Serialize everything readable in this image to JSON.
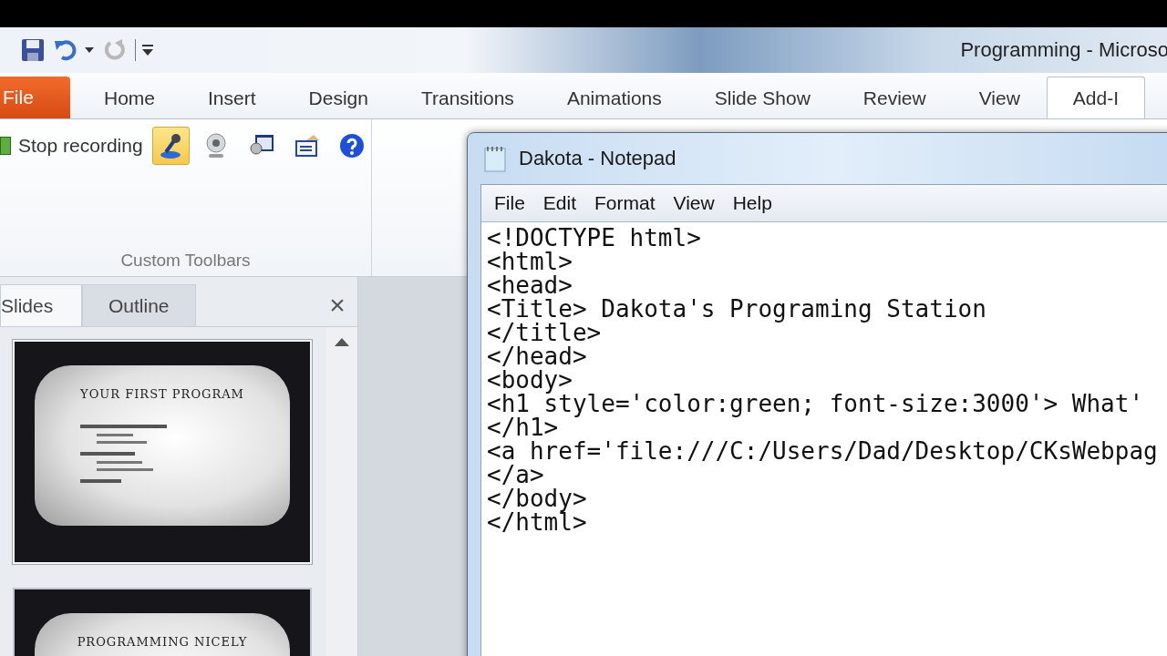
{
  "window": {
    "title": "Programming - Microso"
  },
  "ribbon_tabs": [
    {
      "label": "File",
      "kind": "file",
      "selected": false
    },
    {
      "label": "Home",
      "kind": "tab",
      "selected": false
    },
    {
      "label": "Insert",
      "kind": "tab",
      "selected": false
    },
    {
      "label": "Design",
      "kind": "tab",
      "selected": false
    },
    {
      "label": "Transitions",
      "kind": "tab",
      "selected": false
    },
    {
      "label": "Animations",
      "kind": "tab",
      "selected": false
    },
    {
      "label": "Slide Show",
      "kind": "tab",
      "selected": false
    },
    {
      "label": "Review",
      "kind": "tab",
      "selected": false
    },
    {
      "label": "View",
      "kind": "tab",
      "selected": false
    },
    {
      "label": "Add-I",
      "kind": "tab",
      "selected": true
    }
  ],
  "ribbon_group": {
    "label": "Custom Toolbars",
    "stop_button": "Stop recording",
    "tools": [
      {
        "kind": "narration",
        "pressed": true
      },
      {
        "kind": "webcam",
        "pressed": false
      },
      {
        "kind": "screen",
        "pressed": false
      },
      {
        "kind": "export",
        "pressed": false
      },
      {
        "kind": "help",
        "pressed": false
      }
    ]
  },
  "pane_tabs": [
    {
      "label": "Slides",
      "selected": true
    },
    {
      "label": "Outline",
      "selected": false
    }
  ],
  "pane_close": "×",
  "slides": [
    {
      "title": "YOUR FIRST PROGRAM",
      "selected": true
    },
    {
      "title": "PROGRAMMING NICELY",
      "selected": false
    }
  ],
  "notepad": {
    "title": "Dakota - Notepad",
    "menu": [
      "File",
      "Edit",
      "Format",
      "View",
      "Help"
    ],
    "lines": [
      "<!DOCTYPE html>",
      "<html>",
      "<head>",
      "<Title> Dakota's Programing Station",
      "</title>",
      "</head>",
      "<body>",
      "<h1 style='color:green; font-size:3000'> What'",
      "</h1>",
      "<a href='file:///C:/Users/Dad/Desktop/CKsWebpag",
      "</a>",
      "</body>",
      "</html>"
    ]
  }
}
